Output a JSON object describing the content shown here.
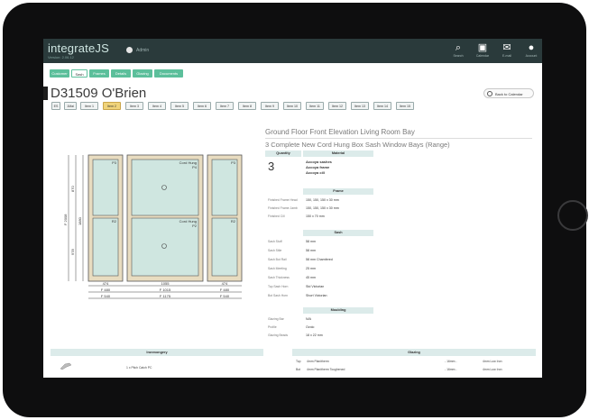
{
  "app": {
    "logo": "integrateJS",
    "version": "Version: 2.06.12",
    "user": "Admin"
  },
  "toolbar": [
    {
      "name": "search",
      "glyph": "⌕",
      "label": "Search"
    },
    {
      "name": "calendar",
      "glyph": "▣",
      "label": "Calendar"
    },
    {
      "name": "email",
      "glyph": "✉",
      "label": "E-mail"
    },
    {
      "name": "user",
      "glyph": "●",
      "label": "Account"
    }
  ],
  "tabs": [
    "Customer",
    "Sash",
    "Frames",
    "Details",
    "Glazing",
    "Documents"
  ],
  "job": {
    "title": "D31509 O'Brien",
    "back_label": "Back to Calendar"
  },
  "items": [
    "ES",
    "1Mai",
    "Item 1",
    "Item 2",
    "Item 3",
    "Item 4",
    "Item 5",
    "Item 6",
    "Item 7",
    "Item 8",
    "Item 9",
    "Item 10",
    "Item 11",
    "Item 12",
    "Item 13",
    "Item 14",
    "Item 15"
  ],
  "active_item": 3,
  "section": {
    "title": "Ground Floor Front Elevation Living Room Bay",
    "subtitle": "3 Complete New Cord Hung Box Sash Window Bays (Range)"
  },
  "material_table": {
    "headers": [
      "Quantity",
      "Material"
    ],
    "quantity": "3",
    "materials": [
      "Accoya sashes",
      "Accoya frame",
      "Accoya cill"
    ]
  },
  "frame": {
    "header": "Frame",
    "rows": [
      {
        "label": "Finished Frame Head",
        "value": "150, 150, 150 x 30 mm"
      },
      {
        "label": "Finished Frame Jamb",
        "value": "150, 150, 150 x 30 mm"
      },
      {
        "label": "Finished Cill",
        "value": "150 x 70 mm"
      }
    ]
  },
  "sash": {
    "header": "Sash",
    "rows": [
      {
        "label": "Sash Stuff",
        "value": "58 mm"
      },
      {
        "label": "Sash Stile",
        "value": "58 mm"
      },
      {
        "label": "Sash Bot Rail",
        "value": "58 mm Chamfered"
      },
      {
        "label": "Sash Meeting",
        "value": "25 mm"
      },
      {
        "label": "Sash Thickness",
        "value": "45 mm"
      },
      {
        "label": "Top Sash Horn",
        "value": "Std Victorian"
      },
      {
        "label": "Bot Sash Horn",
        "value": "Short Victorian"
      }
    ]
  },
  "moulding": {
    "header": "Moulding",
    "rows": [
      {
        "label": "Glazing Bar",
        "value": "N/A"
      },
      {
        "label": "Profile",
        "value": "Ovolo"
      },
      {
        "label": "Glazing Beads",
        "value": "18 x 22 mm"
      }
    ]
  },
  "ironmongery": {
    "header": "Ironmongery",
    "rows": [
      "1 x Pitch Catch PC"
    ]
  },
  "glazing": {
    "header": "Glazing",
    "rows": [
      {
        "pos": "Top",
        "type": "4mm Planitherm",
        "dim": "- 16mm -",
        "lowe": "4mm Low Iron"
      },
      {
        "pos": "Bot",
        "type": "4mm Planitherm Toughened",
        "dim": "- 16mm -",
        "lowe": "4mm Low Iron"
      }
    ]
  },
  "drawing": {
    "panes": [
      {
        "label": "Cord Hung",
        "code": "P4"
      },
      {
        "label": "Cord Hung",
        "code": "P2"
      }
    ],
    "small_labels": [
      "P3",
      "R2",
      "P3",
      "R2"
    ],
    "dims_bottom": [
      "474",
      "1055",
      "474"
    ],
    "dims_inner": [
      "F 480",
      "F 1015",
      "F 480"
    ],
    "dims_outer": [
      "F 540",
      "F 1175",
      "F 540"
    ],
    "dims_left": [
      "1880",
      "F 2008",
      "870",
      "978"
    ]
  },
  "colors": {
    "topbar": "#2a3a3b",
    "accent": "#5cbf9b",
    "active": "#f0d37a"
  }
}
